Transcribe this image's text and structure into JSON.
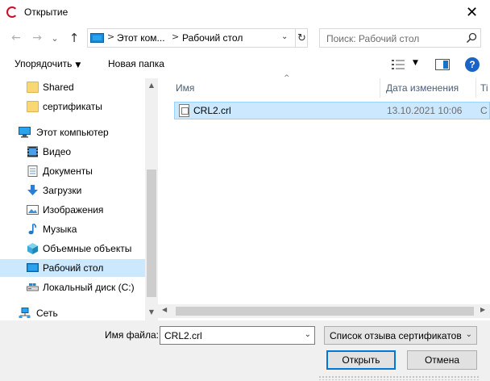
{
  "window": {
    "title": "Открытие",
    "close_glyph": "✕",
    "app_icon": "app-logo-icon"
  },
  "navigation": {
    "back_glyph": "←",
    "forward_glyph": "→",
    "recent_glyph": "⌄",
    "up_glyph": "↑",
    "breadcrumbs": [
      "Этот ком...",
      "Рабочий стол"
    ],
    "crumb_separator": ">",
    "address_dropdown_glyph": "⌄",
    "refresh_glyph": "↻",
    "search_placeholder": "Поиск: Рабочий стол"
  },
  "toolbar": {
    "organize_label": "Упорядочить",
    "new_folder_label": "Новая папка",
    "dropdown_glyph": "▼",
    "help_glyph": "?"
  },
  "nav_pane": {
    "items": [
      {
        "label": "Shared",
        "icon": "folder-icon",
        "selected": false
      },
      {
        "label": "сертификаты",
        "icon": "folder-icon",
        "selected": false
      },
      {
        "label": "Этот компьютер",
        "icon": "computer-icon",
        "selected": false
      },
      {
        "label": "Видео",
        "icon": "video-icon",
        "selected": false
      },
      {
        "label": "Документы",
        "icon": "documents-icon",
        "selected": false
      },
      {
        "label": "Загрузки",
        "icon": "downloads-icon",
        "selected": false
      },
      {
        "label": "Изображения",
        "icon": "pictures-icon",
        "selected": false
      },
      {
        "label": "Музыка",
        "icon": "music-icon",
        "selected": false
      },
      {
        "label": "Объемные объекты",
        "icon": "3d-objects-icon",
        "selected": false
      },
      {
        "label": "Рабочий стол",
        "icon": "desktop-icon",
        "selected": true
      },
      {
        "label": "Локальный диск (C:)",
        "icon": "drive-icon",
        "selected": false
      },
      {
        "label": "Сеть",
        "icon": "network-icon",
        "selected": false
      }
    ],
    "scroll_up_glyph": "▲",
    "scroll_down_glyph": "▼"
  },
  "file_list": {
    "columns": [
      "Имя",
      "Дата изменения",
      "Ti"
    ],
    "sort_glyph": "^",
    "rows": [
      {
        "name": "CRL2.crl",
        "date": "13.10.2021 10:06",
        "type": "C",
        "selected": true
      }
    ],
    "scroll_left_glyph": "◀",
    "scroll_right_glyph": "▶"
  },
  "footer": {
    "filename_label": "Имя файла:",
    "filename_value": "CRL2.crl",
    "filetype_value": "Список отзыва сертификатов",
    "dropdown_glyph": "⌄",
    "open_label": "Открыть",
    "cancel_label": "Отмена"
  },
  "colors": {
    "selection": "#cce8ff",
    "selection_border": "#99d1ff",
    "primary_border": "#0078d7",
    "help_blue": "#1a64c8"
  }
}
